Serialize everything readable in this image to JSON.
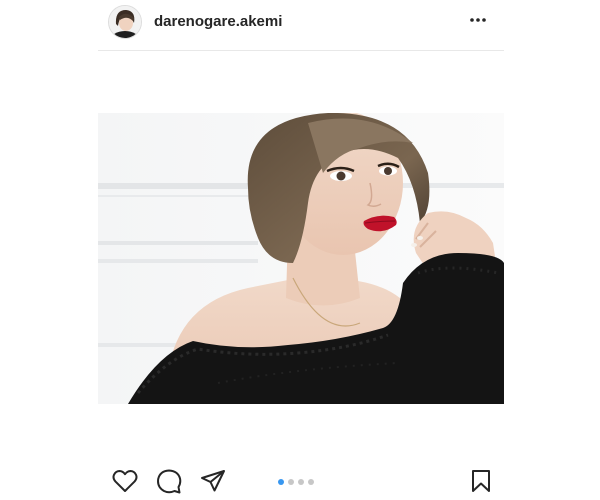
{
  "post": {
    "username": "darenogare.akemi",
    "more_icon": "more-horizontal-icon",
    "carousel": {
      "count": 4,
      "active_index": 0
    }
  },
  "actions": {
    "like_icon": "heart-icon",
    "comment_icon": "comment-icon",
    "share_icon": "paper-plane-icon",
    "save_icon": "bookmark-icon"
  },
  "colors": {
    "text": "#262626",
    "divider": "#e8e8e8",
    "carousel_active": "#3897f0",
    "carousel_inactive": "#c7c7c7"
  }
}
